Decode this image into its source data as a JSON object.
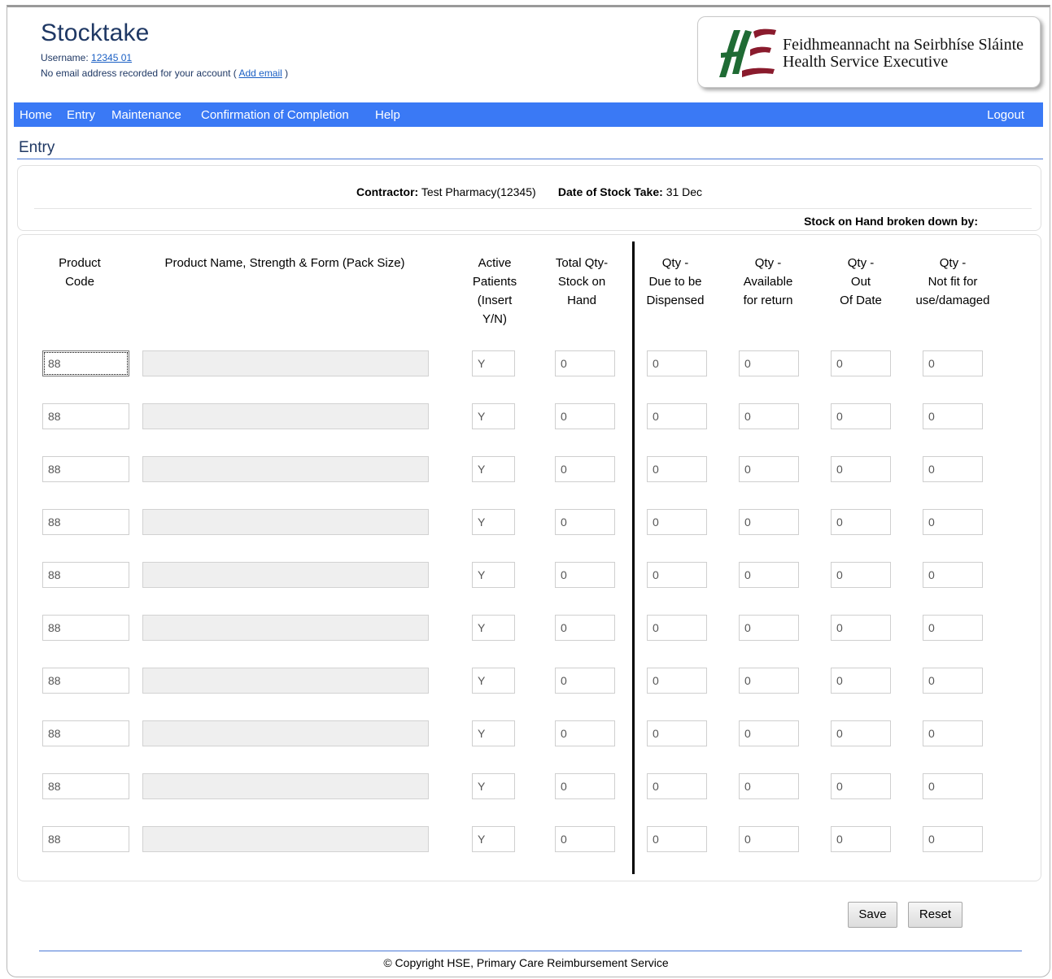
{
  "header": {
    "title": "Stocktake",
    "username_label": "Username:",
    "username_value": "12345 01",
    "email_notice_prefix": "No email address recorded for your account (",
    "add_email_link": "Add email",
    "email_notice_suffix": ")",
    "logo_line1": "Feidhmeannacht na Seirbhíse Sláinte",
    "logo_line2": "Health Service Executive",
    "logo_icon": "hse-logo-icon"
  },
  "nav": {
    "items": [
      "Home",
      "Entry",
      "Maintenance",
      "Confirmation of Completion",
      "Help"
    ],
    "logout": "Logout",
    "color": "#3a79f5"
  },
  "page": {
    "section_title": "Entry",
    "contractor_label": "Contractor:",
    "contractor_value": "Test Pharmacy(12345)",
    "date_label": "Date of Stock Take:",
    "date_value": "31 Dec",
    "stock_on_hand_label": "Stock on Hand broken down by:"
  },
  "columns": [
    [
      "Product",
      "Code"
    ],
    [
      "Product Name, Strength & Form (Pack Size)"
    ],
    [
      "Active",
      "Patients",
      "(Insert",
      "Y/N)"
    ],
    [
      "Total Qty-",
      "Stock on",
      "Hand"
    ],
    [
      "Qty -",
      "Due to be",
      "Dispensed"
    ],
    [
      "Qty -",
      "Available",
      "for return"
    ],
    [
      "Qty -",
      "Out",
      "Of Date"
    ],
    [
      "Qty -",
      "Not fit for",
      "use/damaged"
    ]
  ],
  "rows": [
    {
      "code": "88",
      "name": "",
      "active": "Y",
      "total": "0",
      "due": "0",
      "avail": "0",
      "ood": "0",
      "damaged": "0"
    },
    {
      "code": "88",
      "name": "",
      "active": "Y",
      "total": "0",
      "due": "0",
      "avail": "0",
      "ood": "0",
      "damaged": "0"
    },
    {
      "code": "88",
      "name": "",
      "active": "Y",
      "total": "0",
      "due": "0",
      "avail": "0",
      "ood": "0",
      "damaged": "0"
    },
    {
      "code": "88",
      "name": "",
      "active": "Y",
      "total": "0",
      "due": "0",
      "avail": "0",
      "ood": "0",
      "damaged": "0"
    },
    {
      "code": "88",
      "name": "",
      "active": "Y",
      "total": "0",
      "due": "0",
      "avail": "0",
      "ood": "0",
      "damaged": "0"
    },
    {
      "code": "88",
      "name": "",
      "active": "Y",
      "total": "0",
      "due": "0",
      "avail": "0",
      "ood": "0",
      "damaged": "0"
    },
    {
      "code": "88",
      "name": "",
      "active": "Y",
      "total": "0",
      "due": "0",
      "avail": "0",
      "ood": "0",
      "damaged": "0"
    },
    {
      "code": "88",
      "name": "",
      "active": "Y",
      "total": "0",
      "due": "0",
      "avail": "0",
      "ood": "0",
      "damaged": "0"
    },
    {
      "code": "88",
      "name": "",
      "active": "Y",
      "total": "0",
      "due": "0",
      "avail": "0",
      "ood": "0",
      "damaged": "0"
    },
    {
      "code": "88",
      "name": "",
      "active": "Y",
      "total": "0",
      "due": "0",
      "avail": "0",
      "ood": "0",
      "damaged": "0"
    }
  ],
  "buttons": {
    "save": "Save",
    "reset": "Reset"
  },
  "footer": {
    "copyright": "© Copyright HSE, Primary Care Reimbursement Service"
  }
}
